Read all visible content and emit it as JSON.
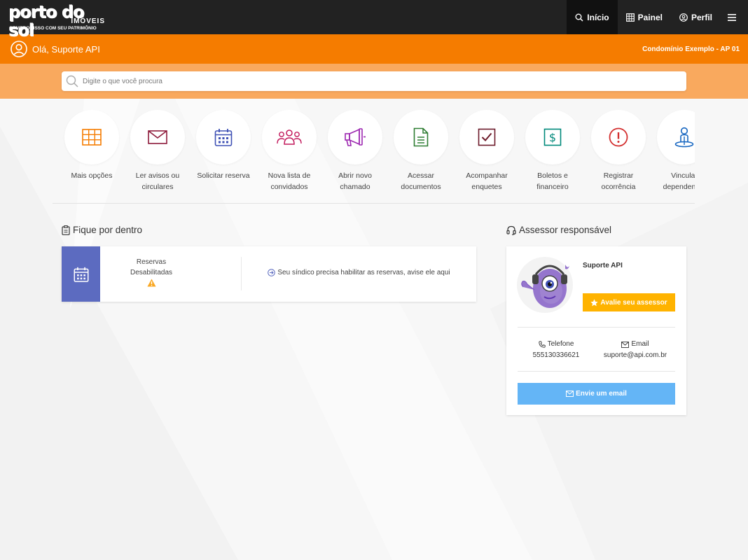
{
  "brand": {
    "logo_text": "porto do sol",
    "logo_sub": "IMÓVEIS",
    "logo_tagline": "COMPROMISSO COM SEU PATRIMÔNIO"
  },
  "nav": {
    "items": [
      {
        "label": "Início",
        "icon": "search-icon",
        "active": true
      },
      {
        "label": "Painel",
        "icon": "grid-icon",
        "active": false
      },
      {
        "label": "Perfil",
        "icon": "user-icon",
        "active": false
      }
    ],
    "menu_icon": "hamburger-icon"
  },
  "header": {
    "greeting": "Olá, Suporte API",
    "condominium": "Condomínio Exemplo - AP 01"
  },
  "search": {
    "placeholder": "Digite o que você procura"
  },
  "quick_actions": [
    {
      "label": "Mais opções",
      "icon": "grid-icon",
      "color": "#f57c00"
    },
    {
      "label": "Ler avisos ou circulares",
      "icon": "envelope-icon",
      "color": "#8e1b3b"
    },
    {
      "label": "Solicitar reserva",
      "icon": "calendar-icon",
      "color": "#3f51b5"
    },
    {
      "label": "Nova lista de convidados",
      "icon": "users-icon",
      "color": "#c2185b"
    },
    {
      "label": "Abrir novo chamado",
      "icon": "megaphone-icon",
      "color": "#9c27b0"
    },
    {
      "label": "Acessar documentos",
      "icon": "document-icon",
      "color": "#2e7d32"
    },
    {
      "label": "Acompanhar enquetes",
      "icon": "checkbox-icon",
      "color": "#6d1b2b"
    },
    {
      "label": "Boletos e financeiro",
      "icon": "dollar-icon",
      "color": "#00897b"
    },
    {
      "label": "Registrar ocorrência",
      "icon": "alert-icon",
      "color": "#d32f2f"
    },
    {
      "label": "Vincular dependentes",
      "icon": "person-pin-icon",
      "color": "#1565c0"
    }
  ],
  "fique": {
    "title": "Fique por dentro",
    "status_line1": "Reservas",
    "status_line2": "Desabilitadas",
    "message": "Seu síndico precisa habilitar as reservas, avise ele aqui"
  },
  "assessor": {
    "title": "Assessor responsável",
    "name": "Suporte API",
    "rate_label": "Avalie seu assessor",
    "phone_label": "Telefone",
    "phone": "555130336621",
    "email_label": "Email",
    "email": "suporte@api.com.br",
    "send_email_label": "Envie um email"
  },
  "colors": {
    "nav_bg": "#222222",
    "orange": "#f57c00",
    "orange_light": "#f9a95e",
    "indigo": "#5c6bc0",
    "amber": "#ffb300",
    "light_blue": "#64b5f6"
  }
}
